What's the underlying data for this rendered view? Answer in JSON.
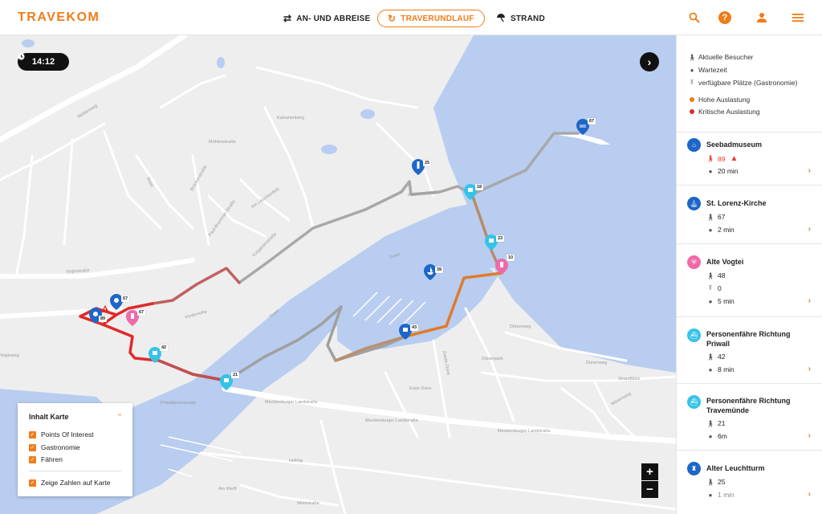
{
  "brand": {
    "logo_text": "TRAVEKOM",
    "accent": "#ef7d1a"
  },
  "nav": [
    {
      "label": "AN- UND ABREISE",
      "icon": "swap-arrows-icon"
    },
    {
      "label": "TRAVERUNDLAUF",
      "icon": "loop-arrow-icon",
      "active": true
    },
    {
      "label": "STRAND",
      "icon": "beach-umbrella-icon"
    }
  ],
  "header_icons": [
    "search-icon",
    "help-icon",
    "user-icon",
    "menu-icon"
  ],
  "map": {
    "time": "14:12",
    "colors": {
      "water": "#b8cdf0",
      "land": "#eeeeee",
      "poi_blue": "#1e66c8",
      "ferry_cyan": "#35c3e8",
      "food_pink": "#f06aa8",
      "critical": "#e02a2a",
      "high": "#ef7d1a",
      "normal": "#a0a0a0"
    },
    "street_labels": [
      "Mühlenweg",
      "Vogtsstraße",
      "Mühlenstraße",
      "Rose",
      "Brückenstraße",
      "Paul-Brummer-Straße",
      "Am Leuchtenfeld",
      "Kalvarienberg",
      "Kurgartenstraße",
      "Vorderreihe",
      "Trave",
      "Trave",
      "Dünenweg",
      "Dünenweg",
      "Strandblick",
      "Erste Düne",
      "Zweite Düne",
      "Mecklenburger Landstraße",
      "Mecklenburger Landstraße",
      "Mecklenburger Landstraße",
      "Helling",
      "Am Werft",
      "Wiekstraße",
      "Priwallpromenade",
      "Möwenweg",
      "Dünenpark",
      "Fischereihafen",
      "Vogtsweg"
    ],
    "markers": [
      {
        "type": "poi",
        "badge": "89",
        "alert": true
      },
      {
        "type": "poi",
        "badge": "67"
      },
      {
        "type": "food",
        "badge": "67"
      },
      {
        "type": "ferry",
        "badge": "42"
      },
      {
        "type": "ferry",
        "badge": "21"
      },
      {
        "type": "ferry",
        "badge": "43"
      },
      {
        "type": "ferry",
        "badge": "39"
      },
      {
        "type": "ferry",
        "badge": "23"
      },
      {
        "type": "food",
        "badge": "10"
      },
      {
        "type": "ferry",
        "badge": "18"
      },
      {
        "type": "lighthouse",
        "badge": "25"
      },
      {
        "type": "poi",
        "badge": "67"
      }
    ]
  },
  "legend": {
    "title": "Inhalt Karte",
    "items": [
      "Points Of Interest",
      "Gastronomie",
      "Fähren"
    ],
    "extra": "Zeige Zahlen auf Karte"
  },
  "side": {
    "key": [
      {
        "icon": "walker-icon",
        "label": "Aktuelle Besucher"
      },
      {
        "icon": "clock-icon",
        "label": "Wartezeit"
      },
      {
        "icon": "table-chair-icon",
        "label": "verfügbare Plätze (Gastronomie)"
      },
      {
        "color": "#ef7d1a",
        "label": "Hohe Auslastung"
      },
      {
        "color": "#e02a2a",
        "label": "Kritische Auslastung"
      }
    ],
    "pois": [
      {
        "name": "Seebadmuseum",
        "icon": "museum-icon",
        "color": "#1e66c8",
        "visitors": "89",
        "critical": true,
        "wait": "20 min"
      },
      {
        "name": "St. Lorenz-Kirche",
        "icon": "church-icon",
        "color": "#1e66c8",
        "visitors": "67",
        "wait": "2 min"
      },
      {
        "name": "Alte Vogtei",
        "icon": "fork-knife-icon",
        "color": "#f06aa8",
        "visitors": "48",
        "seats": "0",
        "wait": "5 min"
      },
      {
        "name": "Personenfähre Richtung Priwall",
        "icon": "ferry-icon",
        "color": "#35c3e8",
        "visitors": "42",
        "wait": "8 min"
      },
      {
        "name": "Personenfähre Richtung Travemünde",
        "icon": "ferry-icon",
        "color": "#35c3e8",
        "visitors": "21",
        "wait": "6m"
      },
      {
        "name": "Alter Leuchtturm",
        "icon": "lighthouse-icon",
        "color": "#1e66c8",
        "visitors": "25",
        "wait": "1 min"
      }
    ]
  }
}
